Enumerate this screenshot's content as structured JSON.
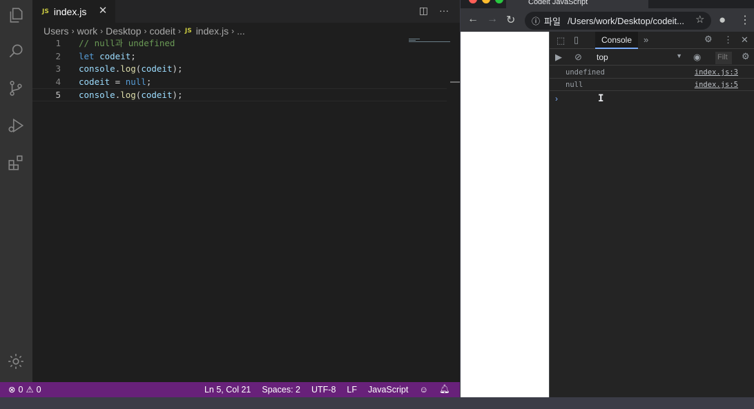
{
  "editor": {
    "tab": {
      "badge": "JS",
      "label": "index.js",
      "close": "✕"
    },
    "actions": {
      "split": "◫",
      "more": "···"
    },
    "breadcrumb": {
      "items": [
        "Users",
        "work",
        "Desktop",
        "codeit"
      ],
      "file_badge": "JS",
      "file": "index.js",
      "tail": "..."
    },
    "lines": [
      {
        "num": "1",
        "tokens": [
          {
            "t": "// null과 undefined",
            "c": "comment"
          }
        ]
      },
      {
        "num": "2",
        "tokens": [
          {
            "t": "let ",
            "c": "kw"
          },
          {
            "t": "codeit",
            "c": "var"
          },
          {
            "t": ";",
            "c": "plain"
          }
        ]
      },
      {
        "num": "3",
        "tokens": [
          {
            "t": "console",
            "c": "var"
          },
          {
            "t": ".",
            "c": "plain"
          },
          {
            "t": "log",
            "c": "fn"
          },
          {
            "t": "(",
            "c": "plain"
          },
          {
            "t": "codeit",
            "c": "var"
          },
          {
            "t": ");",
            "c": "plain"
          }
        ]
      },
      {
        "num": "4",
        "tokens": [
          {
            "t": "codeit",
            "c": "var"
          },
          {
            "t": " = ",
            "c": "plain"
          },
          {
            "t": "null",
            "c": "kw"
          },
          {
            "t": ";",
            "c": "plain"
          }
        ]
      },
      {
        "num": "5",
        "tokens": [
          {
            "t": "console",
            "c": "var"
          },
          {
            "t": ".",
            "c": "plain"
          },
          {
            "t": "log",
            "c": "fn"
          },
          {
            "t": "(",
            "c": "plain"
          },
          {
            "t": "codeit",
            "c": "var"
          },
          {
            "t": ");",
            "c": "plain"
          }
        ]
      }
    ],
    "activity_icons": [
      "explorer-icon",
      "search-icon",
      "source-control-icon",
      "run-debug-icon",
      "extensions-icon",
      "settings-gear-icon"
    ]
  },
  "statusbar": {
    "errors": "0",
    "warnings": "0",
    "position": "Ln 5, Col 21",
    "spaces": "Spaces: 2",
    "encoding": "UTF-8",
    "eol": "LF",
    "language": "JavaScript",
    "color": "#68217a"
  },
  "browser": {
    "tab_title": "Codeit JavaScript",
    "omnibox": {
      "scheme_label": "파일",
      "url": "/Users/work/Desktop/codeit..."
    },
    "devtools": {
      "active_tab": "Console",
      "context": "top",
      "filter_placeholder": "Filt",
      "logs": [
        {
          "message": "undefined",
          "source": "index.js:3"
        },
        {
          "message": "null",
          "source": "index.js:5"
        }
      ],
      "prompt": "›"
    }
  }
}
